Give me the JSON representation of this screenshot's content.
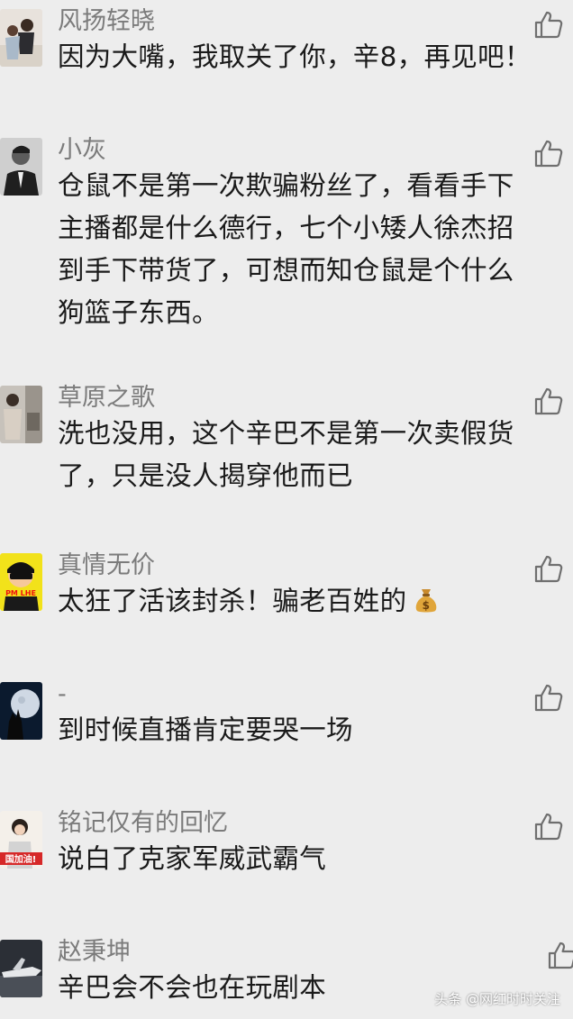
{
  "comments": [
    {
      "name": "风扬轻晓",
      "text": "因为大嘴，我取关了你，辛8，再见吧！"
    },
    {
      "name": "小灰",
      "text": "仓鼠不是第一次欺骗粉丝了，看看手下\n主播都是什么德行，七个小矮人徐杰招\n到手下带货了，可想而知仓鼠是个什么\n狗篮子东西。"
    },
    {
      "name": "草原之歌",
      "text": "洗也没用，这个辛巴不是第一次卖假货\n了，只是没人揭穿他而已"
    },
    {
      "name": "真情无价",
      "text": "太狂了活该封杀！骗老百姓的"
    },
    {
      "name": "-",
      "text": "到时候直播肯定要哭一场"
    },
    {
      "name": "铭记仅有的回忆",
      "text": "说白了克家军威武霸气"
    },
    {
      "name": "赵秉坤",
      "text": "辛巴会不会也在玩剧本"
    }
  ],
  "avatar_texts": {
    "c3": "PM LHE",
    "c5": "国加油!"
  },
  "icons": {
    "like": "thumbs-up-icon",
    "emoji": "money-bag-icon"
  },
  "colors": {
    "background": "#ededed",
    "name": "#7b7b7b",
    "text": "#1a1a1a",
    "icon": "#6f6f6f"
  },
  "watermark": "头条 @网红时时关注"
}
